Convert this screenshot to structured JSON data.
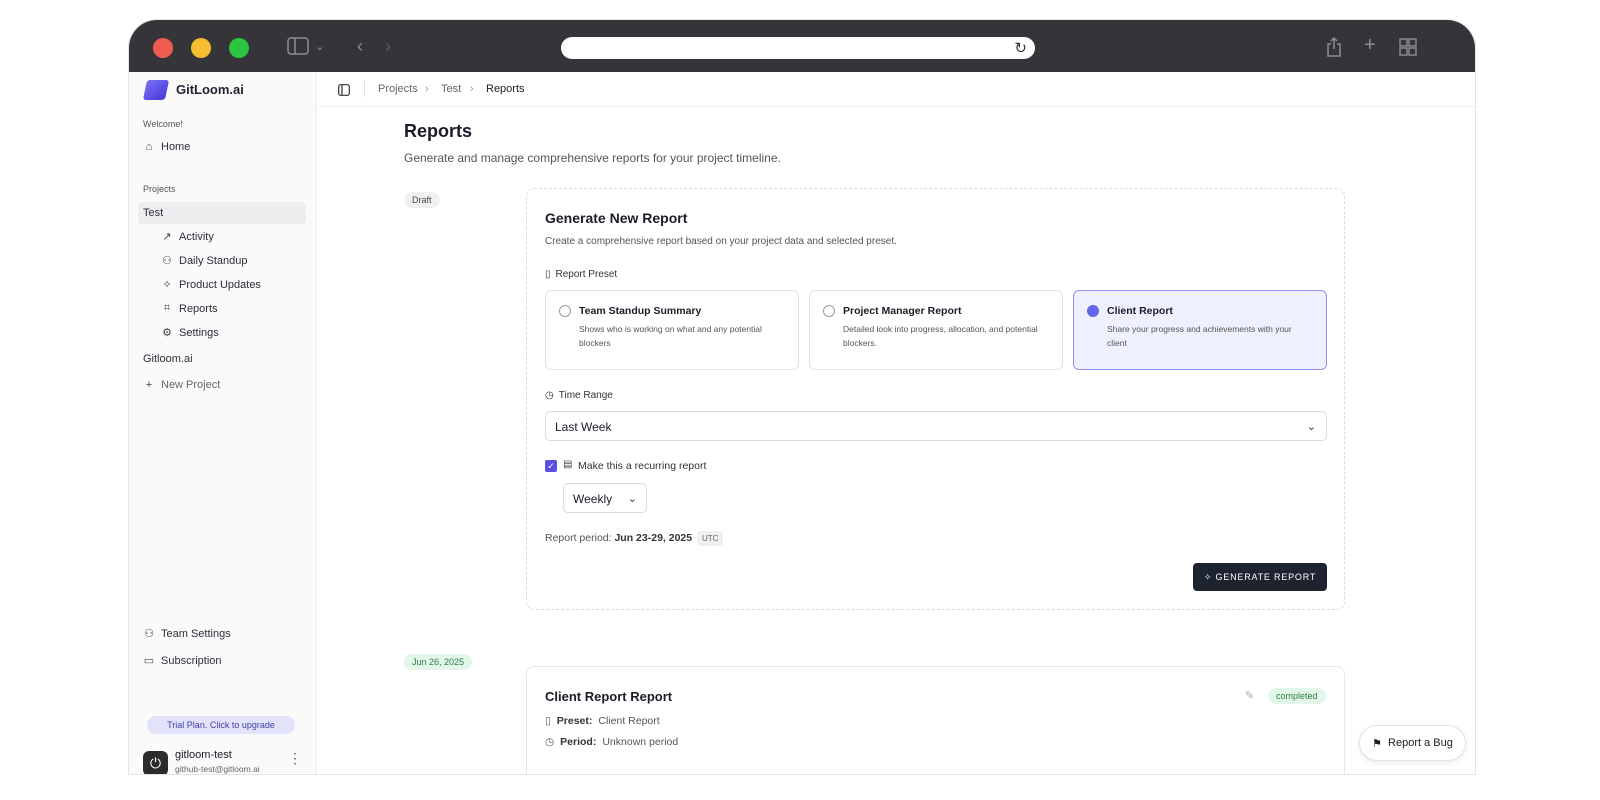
{
  "browser": {
    "colors": {
      "close": "#ee5d50",
      "minimize": "#f6bd2e",
      "maximize": "#2bc641"
    },
    "icons": [
      "sidebar-toggle-icon",
      "back-icon",
      "forward-icon",
      "reload-icon",
      "share-icon",
      "new-tab-icon",
      "tab-overview-icon"
    ]
  },
  "sidebar": {
    "brand": "GitLoom.ai",
    "welcome_label": "Welcome!",
    "home": "Home",
    "projects_label": "Projects",
    "active_project": "Test",
    "project_items": [
      {
        "label": "Activity",
        "icon": "trending-up-icon"
      },
      {
        "label": "Daily Standup",
        "icon": "users-icon"
      },
      {
        "label": "Product Updates",
        "icon": "sparkle-icon"
      },
      {
        "label": "Reports",
        "icon": "tag-icon"
      },
      {
        "label": "Settings",
        "icon": "gear-icon"
      }
    ],
    "other_project": "Gitloom.ai",
    "new_project": "New Project",
    "team_settings": "Team Settings",
    "subscription": "Subscription",
    "trial_banner": "Trial Plan. Click to upgrade",
    "user": {
      "name": "gitloom-test",
      "email": "github-test@gitloom.ai"
    }
  },
  "breadcrumb": [
    "Projects",
    "Test",
    "Reports"
  ],
  "page": {
    "title": "Reports",
    "subtitle": "Generate and manage comprehensive reports for your project timeline."
  },
  "draft_badge": "Draft",
  "generate_card": {
    "title": "Generate New Report",
    "subtitle": "Create a comprehensive report based on your project data and selected preset.",
    "preset_label": "Report Preset",
    "presets": [
      {
        "title": "Team Standup Summary",
        "desc": "Shows who is working on what and any potential blockers",
        "selected": false
      },
      {
        "title": "Project Manager Report",
        "desc": "Detailed look into progress, allocation, and potential blockers.",
        "selected": false
      },
      {
        "title": "Client Report",
        "desc": "Share your progress and achievements with your client",
        "selected": true
      }
    ],
    "time_range_label": "Time Range",
    "time_range_value": "Last Week",
    "recurring_label": "Make this a recurring report",
    "recurring_checked": true,
    "recurring_frequency": "Weekly",
    "report_period_label": "Report period:",
    "report_period_value": "Jun 23-29, 2025",
    "timezone": "UTC",
    "generate_button": "GENERATE REPORT"
  },
  "report_entry": {
    "date_badge": "Jun 26, 2025",
    "title": "Client Report Report",
    "status": "completed",
    "preset_label": "Preset:",
    "preset_value": "Client Report",
    "period_label": "Period:",
    "period_value": "Unknown period"
  },
  "bug_button": "Report a Bug"
}
